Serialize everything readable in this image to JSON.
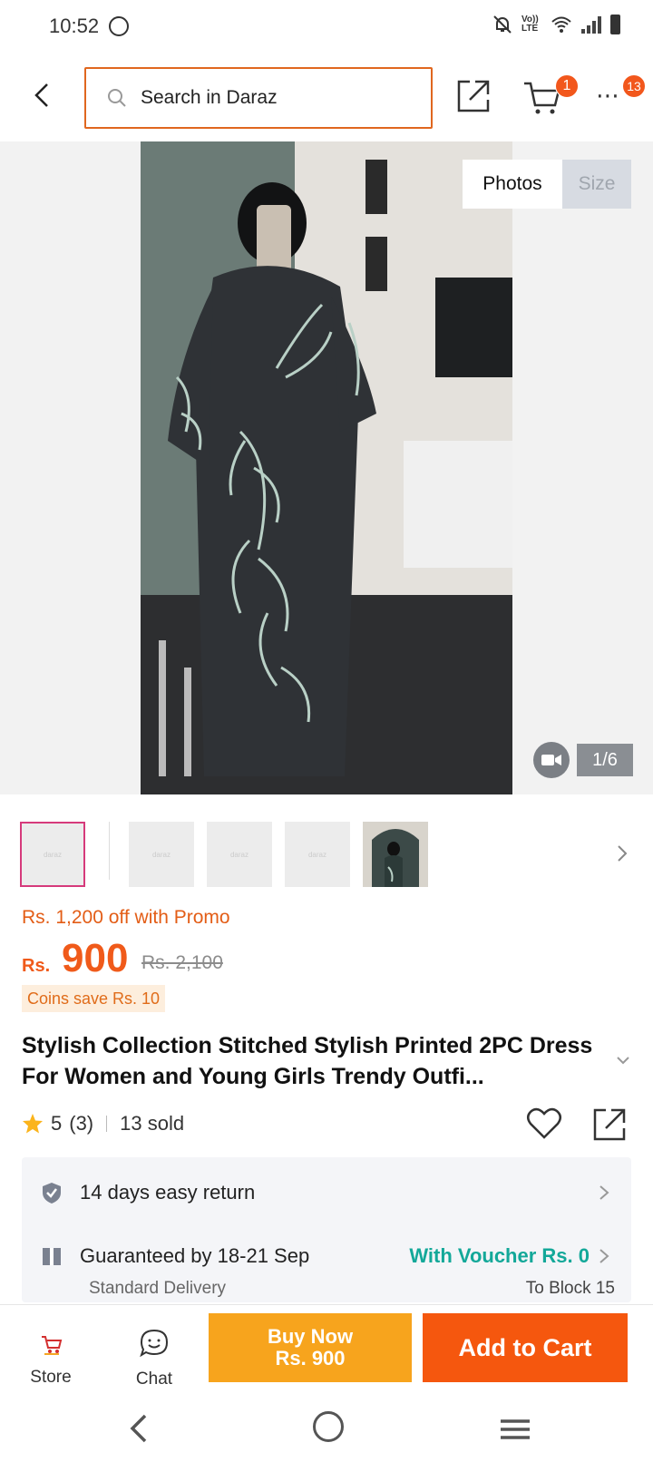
{
  "status_bar": {
    "time": "10:52",
    "network_label": "Vo)) LTE"
  },
  "header": {
    "search_placeholder": "Search in Daraz",
    "cart_badge": "1",
    "more_badge": "13"
  },
  "gallery": {
    "tab_photos": "Photos",
    "tab_size": "Size",
    "counter": "1/6",
    "thumb_placeholder": "daraz"
  },
  "price": {
    "promo": "Rs. 1,200 off with Promo",
    "currency": "Rs.",
    "amount": "900",
    "original": "Rs. 2,100",
    "coins": "Coins save Rs. 10"
  },
  "product": {
    "title": "Stylish Collection Stitched Stylish Printed 2PC Dress For Women and Young Girls Trendy Outfi...",
    "rating": "5",
    "reviews": "(3)",
    "sold": "13 sold"
  },
  "info": {
    "return_text": "14 days easy return",
    "guarantee_text": "Guaranteed by 18-21 Sep",
    "voucher_text": "With Voucher Rs. 0",
    "delivery_type": "Standard Delivery",
    "destination": "To Block 15"
  },
  "bottom": {
    "store_label": "Store",
    "chat_label": "Chat",
    "buy_now_label": "Buy Now",
    "buy_now_price": "Rs. 900",
    "add_to_cart_label": "Add to Cart"
  },
  "colors": {
    "accent": "#f5570e",
    "buy_now": "#f7a41d",
    "voucher": "#13a899"
  }
}
